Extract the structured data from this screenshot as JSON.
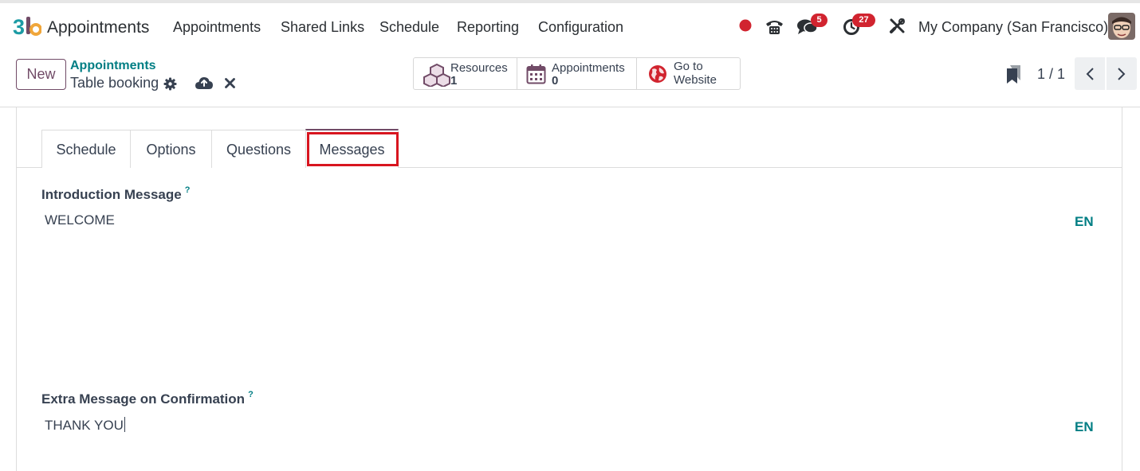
{
  "app": {
    "name": "Appointments"
  },
  "menu": [
    "Appointments",
    "Shared Links",
    "Schedule",
    "Reporting",
    "Configuration"
  ],
  "systray": {
    "chat_badge": "5",
    "activity_badge": "27",
    "company": "My Company (San Francisco)",
    "icons": [
      "status-dot-icon",
      "phone-icon",
      "chat-icon",
      "clock-icon",
      "tools-icon",
      "avatar"
    ]
  },
  "control": {
    "new_label": "New",
    "breadcrumb_parent": "Appointments",
    "breadcrumb_current": "Table booking",
    "smart_buttons": [
      {
        "label": "Resources",
        "value": "1",
        "icon": "cubes-icon"
      },
      {
        "label": "Appointments",
        "value": "0",
        "icon": "calendar-icon"
      },
      {
        "label": "Go to",
        "label2": "Website",
        "icon": "globe-icon"
      }
    ],
    "pager": "1 / 1"
  },
  "tabs": [
    "Schedule",
    "Options",
    "Questions",
    "Messages"
  ],
  "active_tab": "Messages",
  "fields": {
    "intro_label": "Introduction Message",
    "intro_value": "WELCOME",
    "confirm_label": "Extra Message on Confirmation",
    "confirm_value": "THANK YOU",
    "help_mark": "?",
    "lang": "EN"
  },
  "colors": {
    "brand": "#714b67",
    "link": "#017e84",
    "badge": "#d1242f",
    "highlight": "#d8151f"
  }
}
